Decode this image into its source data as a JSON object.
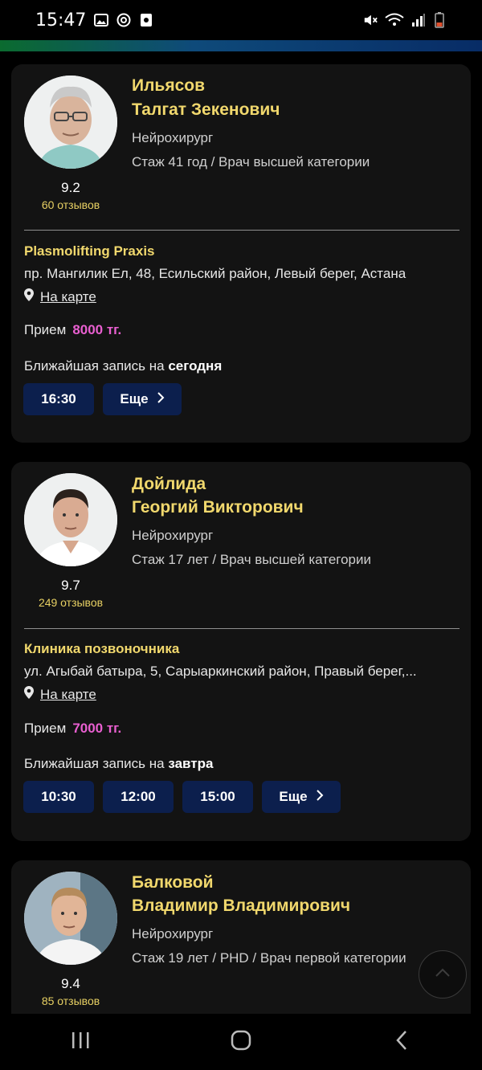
{
  "status_bar": {
    "time": "15:47",
    "left_icons": [
      "image-icon",
      "at-icon",
      "app-icon"
    ],
    "right_icons": [
      "mute-icon",
      "wifi-icon",
      "signal-icon",
      "battery-icon"
    ]
  },
  "colors": {
    "accent_name": "#f1d86d",
    "price": "#e95fd0",
    "slot_bg": "#0c1f4d",
    "card_bg": "#131313"
  },
  "doctors": [
    {
      "name_line1": "Ильясов",
      "name_line2": "Талгат Зекенович",
      "specialty": "Нейрохирург",
      "experience": "Стаж 41 год / Врач высшей категории",
      "rating": "9.2",
      "reviews": "60 отзывов",
      "clinic": "Plasmolifting Praxis",
      "address": "пр. Мангилик Ел, 48, Есильский район, Левый берег, Астана",
      "map_link": "На карте",
      "price_label": "Прием",
      "price": "8000 тг.",
      "next_label": "Ближайшая запись на",
      "next_day": "сегодня",
      "slots": [
        "16:30"
      ],
      "more_label": "Еще"
    },
    {
      "name_line1": "Дойлида",
      "name_line2": "Георгий Викторович",
      "specialty": "Нейрохирург",
      "experience": "Стаж 17 лет / Врач высшей категории",
      "rating": "9.7",
      "reviews": "249 отзывов",
      "clinic": "Клиника позвоночника",
      "address": "ул. Агыбай батыра, 5, Сарыаркинский район, Правый берег,...",
      "map_link": "На карте",
      "price_label": "Прием",
      "price": "7000 тг.",
      "next_label": "Ближайшая запись на",
      "next_day": "завтра",
      "slots": [
        "10:30",
        "12:00",
        "15:00"
      ],
      "more_label": "Еще"
    },
    {
      "name_line1": "Балковой",
      "name_line2": "Владимир Владимирович",
      "specialty": "Нейрохирург",
      "experience": "Стаж 19 лет / PHD / Врач первой категории",
      "rating": "9.4",
      "reviews": "85 отзывов"
    }
  ],
  "nav": {
    "buttons": [
      "recent-apps-icon",
      "home-icon",
      "back-icon"
    ]
  }
}
